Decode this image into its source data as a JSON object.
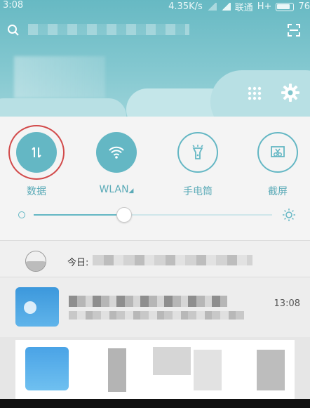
{
  "status_bar": {
    "time": "3:08",
    "net_speed": "4.35K/s",
    "carrier": "联通",
    "network_type": "H+",
    "battery": "76"
  },
  "header": {
    "search_icon": "search-icon",
    "scan_icon": "scan-icon",
    "grid_icon": "grid-icon",
    "settings_icon": "gear-icon"
  },
  "quick_toggles": [
    {
      "label": "数据",
      "icon": "data-arrows-icon",
      "state": "on",
      "highlighted": true
    },
    {
      "label": "WLAN",
      "icon": "wifi-icon",
      "state": "on"
    },
    {
      "label": "手电筒",
      "icon": "flashlight-icon",
      "state": "off"
    },
    {
      "label": "截屏",
      "icon": "screenshot-icon",
      "state": "off"
    }
  ],
  "brightness": {
    "level": 0.38,
    "low_icon": "brightness-low-icon",
    "high_icon": "sun-icon"
  },
  "notifications": {
    "today_label": "今日:",
    "item": {
      "time": "13:08"
    }
  },
  "colors": {
    "accent": "#64b7c4",
    "highlight_ring": "#d24a4a",
    "header_top": "#67b9c3"
  }
}
